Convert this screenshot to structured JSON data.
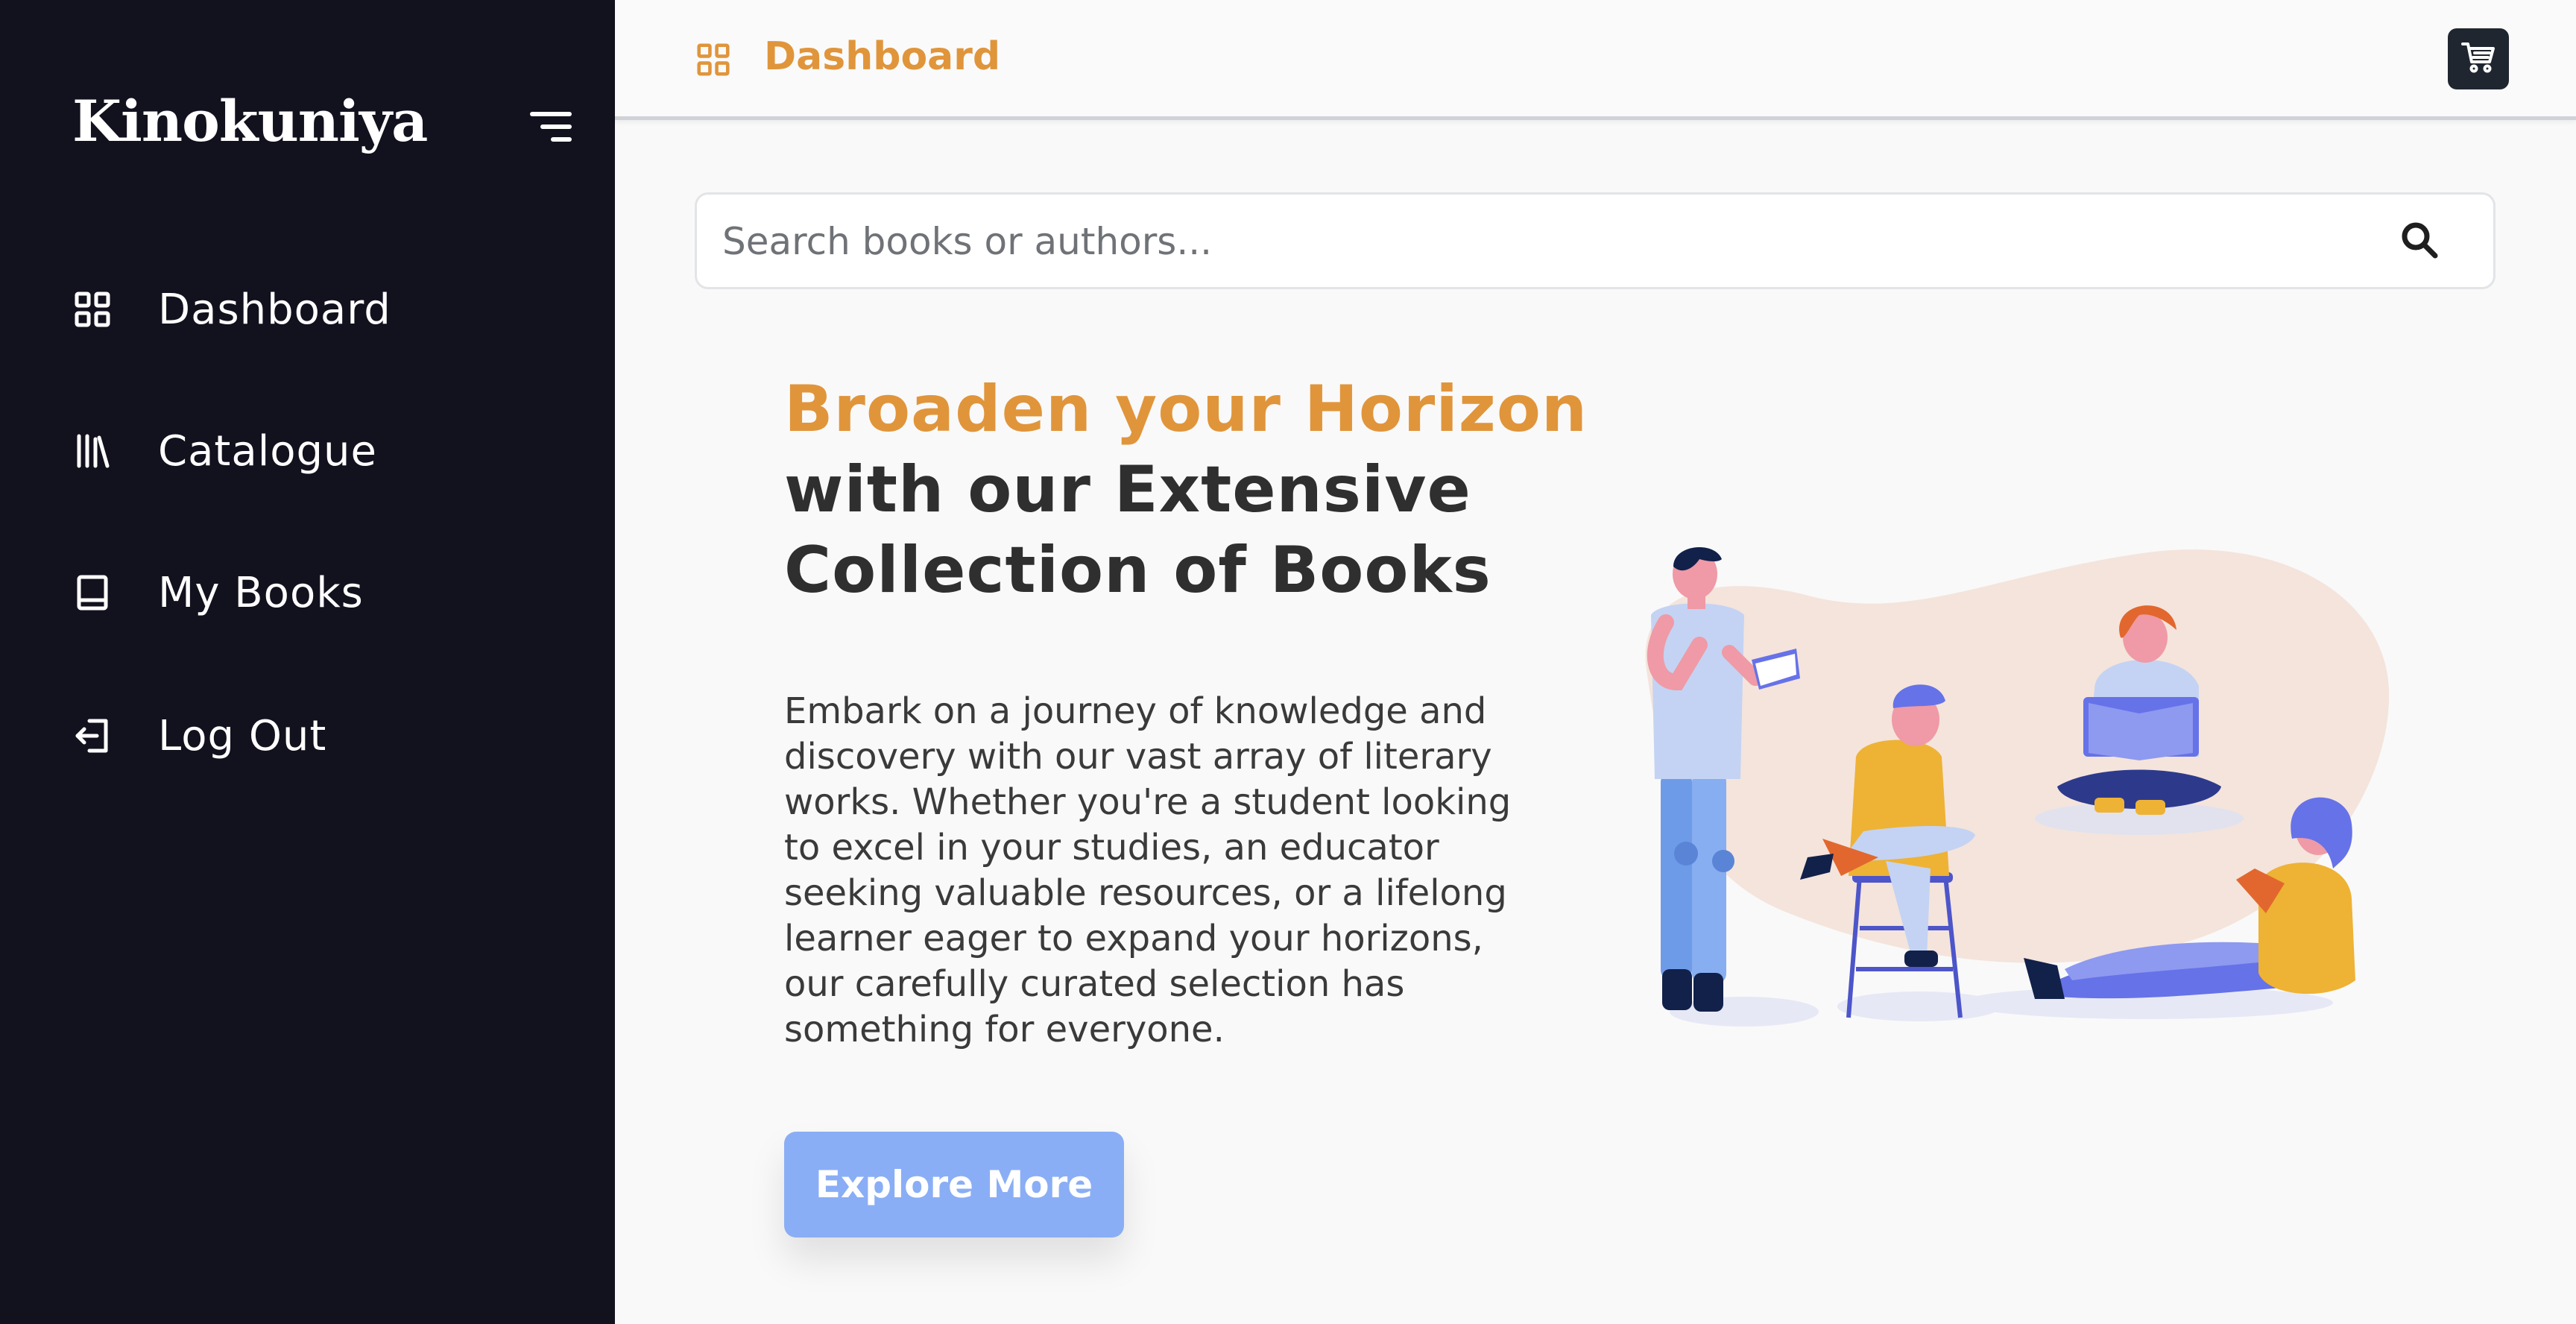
{
  "app": {
    "brand": "Kinokuniya"
  },
  "sidebar": {
    "items": [
      {
        "label": "Dashboard",
        "icon": "grid-icon"
      },
      {
        "label": "Catalogue",
        "icon": "library-icon"
      },
      {
        "label": "My Books",
        "icon": "book-icon"
      },
      {
        "label": "Log Out",
        "icon": "logout-icon"
      }
    ]
  },
  "header": {
    "breadcrumb": "Dashboard",
    "breadcrumb_icon": "grid-icon",
    "cart_icon": "cart-icon"
  },
  "search": {
    "placeholder": "Search books or authors...",
    "value": ""
  },
  "hero": {
    "title_accent": "Broaden your Horizon",
    "title_rest": "with our Extensive Collection of Books",
    "body": "Embark on a journey of knowledge and discovery with our vast array of literary works. Whether you're a student looking to excel in your studies, an educator seeking valuable resources, or a lifelong learner eager to expand your horizons, our carefully curated selection has something for everyone.",
    "cta_label": "Explore More"
  },
  "colors": {
    "sidebar_bg": "#12111e",
    "accent": "#e0953b",
    "cta": "#8aaef5",
    "cart_bg": "#1f2630"
  }
}
